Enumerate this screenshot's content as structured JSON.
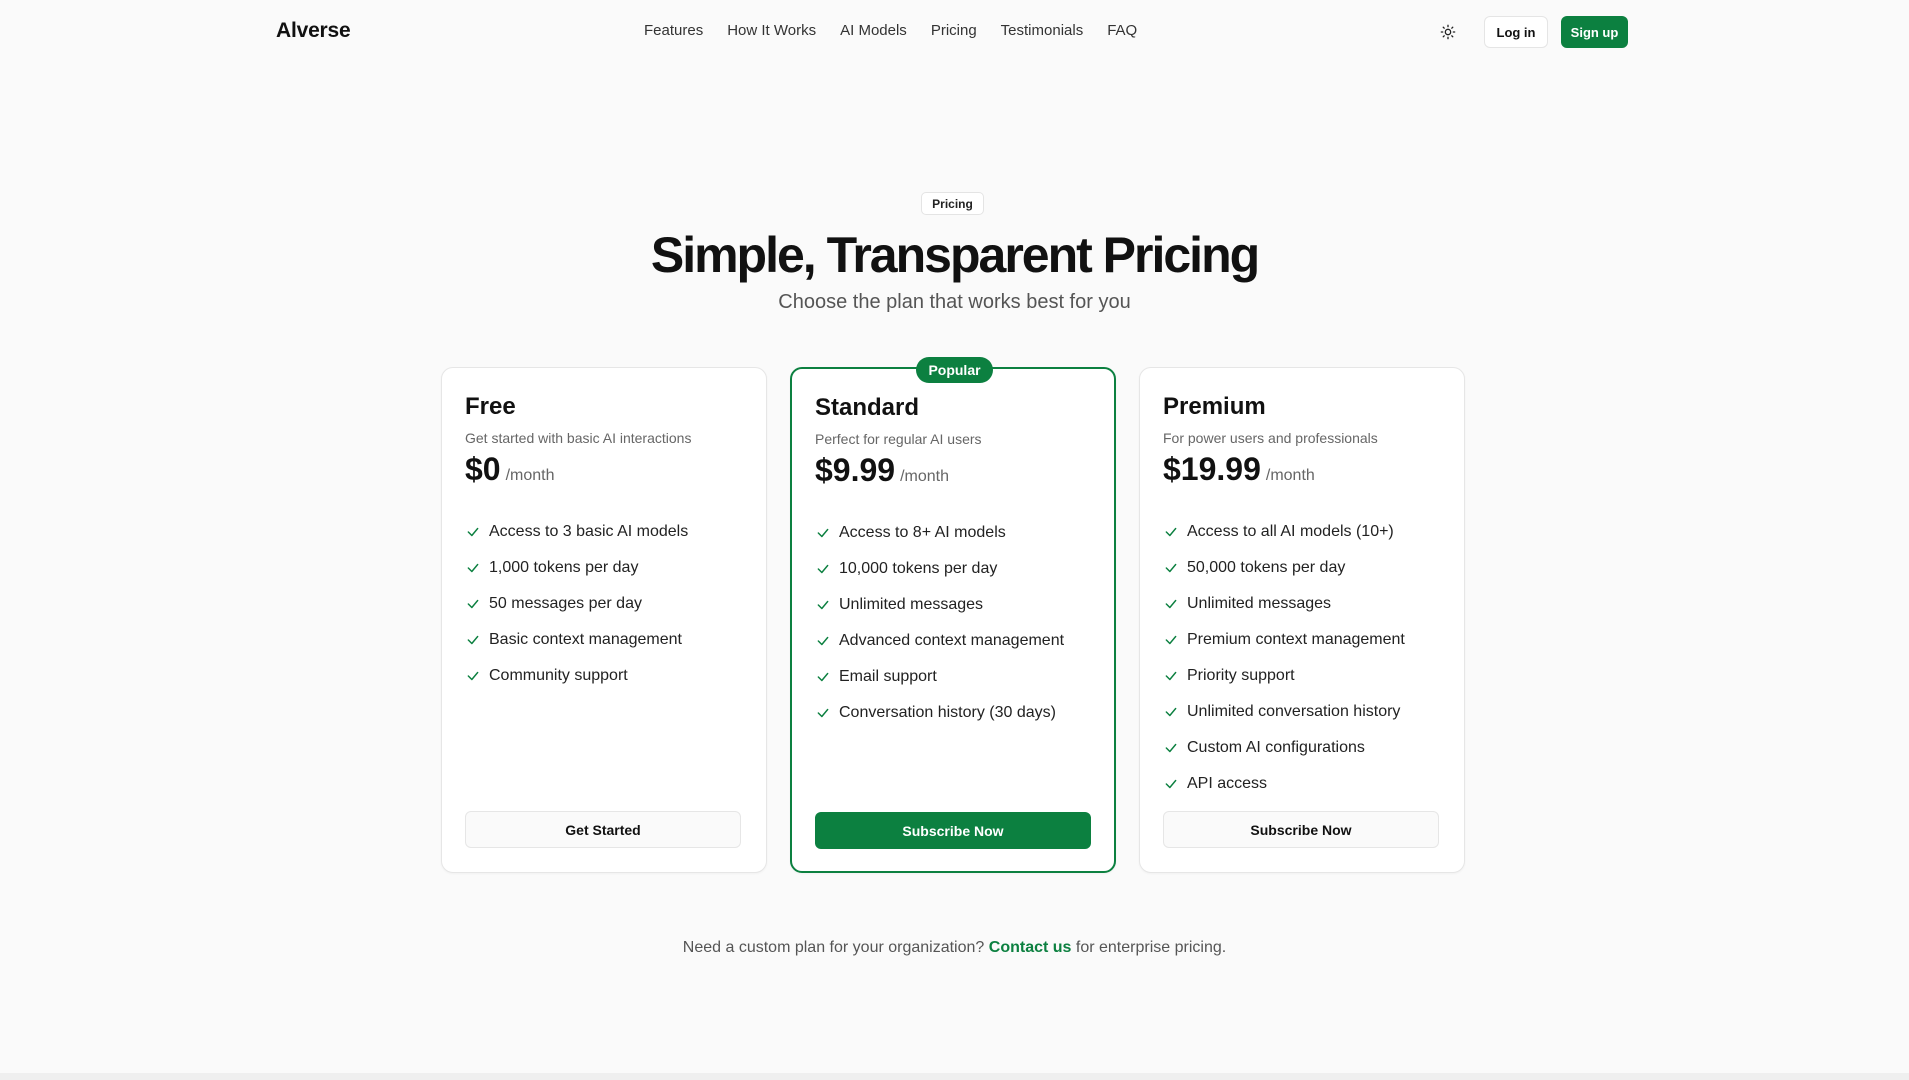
{
  "brand": {
    "name": "Alverse"
  },
  "nav": {
    "links": [
      "Features",
      "How It Works",
      "AI Models",
      "Pricing",
      "Testimonials",
      "FAQ"
    ],
    "login_label": "Log in",
    "signup_label": "Sign up"
  },
  "hero": {
    "badge": "Pricing",
    "title": "Simple, Transparent Pricing",
    "subtitle": "Choose the plan that works best for you"
  },
  "plans": [
    {
      "name": "Free",
      "description": "Get started with basic AI interactions",
      "price": "$0",
      "period": "/month",
      "features": [
        "Access to 3 basic AI models",
        "1,000 tokens per day",
        "50 messages per day",
        "Basic context management",
        "Community support"
      ],
      "button": "Get Started"
    },
    {
      "name": "Standard",
      "badge": "Popular",
      "description": "Perfect for regular AI users",
      "price": "$9.99",
      "period": "/month",
      "features": [
        "Access to 8+ AI models",
        "10,000 tokens per day",
        "Unlimited messages",
        "Advanced context management",
        "Email support",
        "Conversation history (30 days)"
      ],
      "button": "Subscribe Now"
    },
    {
      "name": "Premium",
      "description": "For power users and professionals",
      "price": "$19.99",
      "period": "/month",
      "features": [
        "Access to all AI models (10+)",
        "50,000 tokens per day",
        "Unlimited messages",
        "Premium context management",
        "Priority support",
        "Unlimited conversation history",
        "Custom AI configurations",
        "API access"
      ],
      "button": "Subscribe Now"
    }
  ],
  "custom": {
    "before": "Need a custom plan for your organization?",
    "link": "Contact us",
    "after": "for enterprise pricing."
  },
  "colors": {
    "accent": "#0c8040",
    "background": "#fafafa"
  },
  "icons": {
    "theme_toggle": "sun-icon",
    "feature_check": "check-icon"
  }
}
